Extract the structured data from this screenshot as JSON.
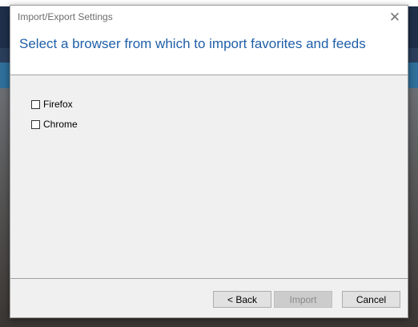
{
  "window": {
    "title": "Import/Export Settings",
    "close_icon": "close-icon"
  },
  "header": {
    "heading": "Select a browser from which to import favorites and feeds"
  },
  "options": [
    {
      "label": "Firefox",
      "checked": false
    },
    {
      "label": "Chrome",
      "checked": false
    }
  ],
  "buttons": {
    "back": "< Back",
    "import": "Import",
    "import_disabled": true,
    "cancel": "Cancel"
  },
  "colors": {
    "heading": "#1f5fa8",
    "dialog_bg": "#f0f0f0"
  }
}
